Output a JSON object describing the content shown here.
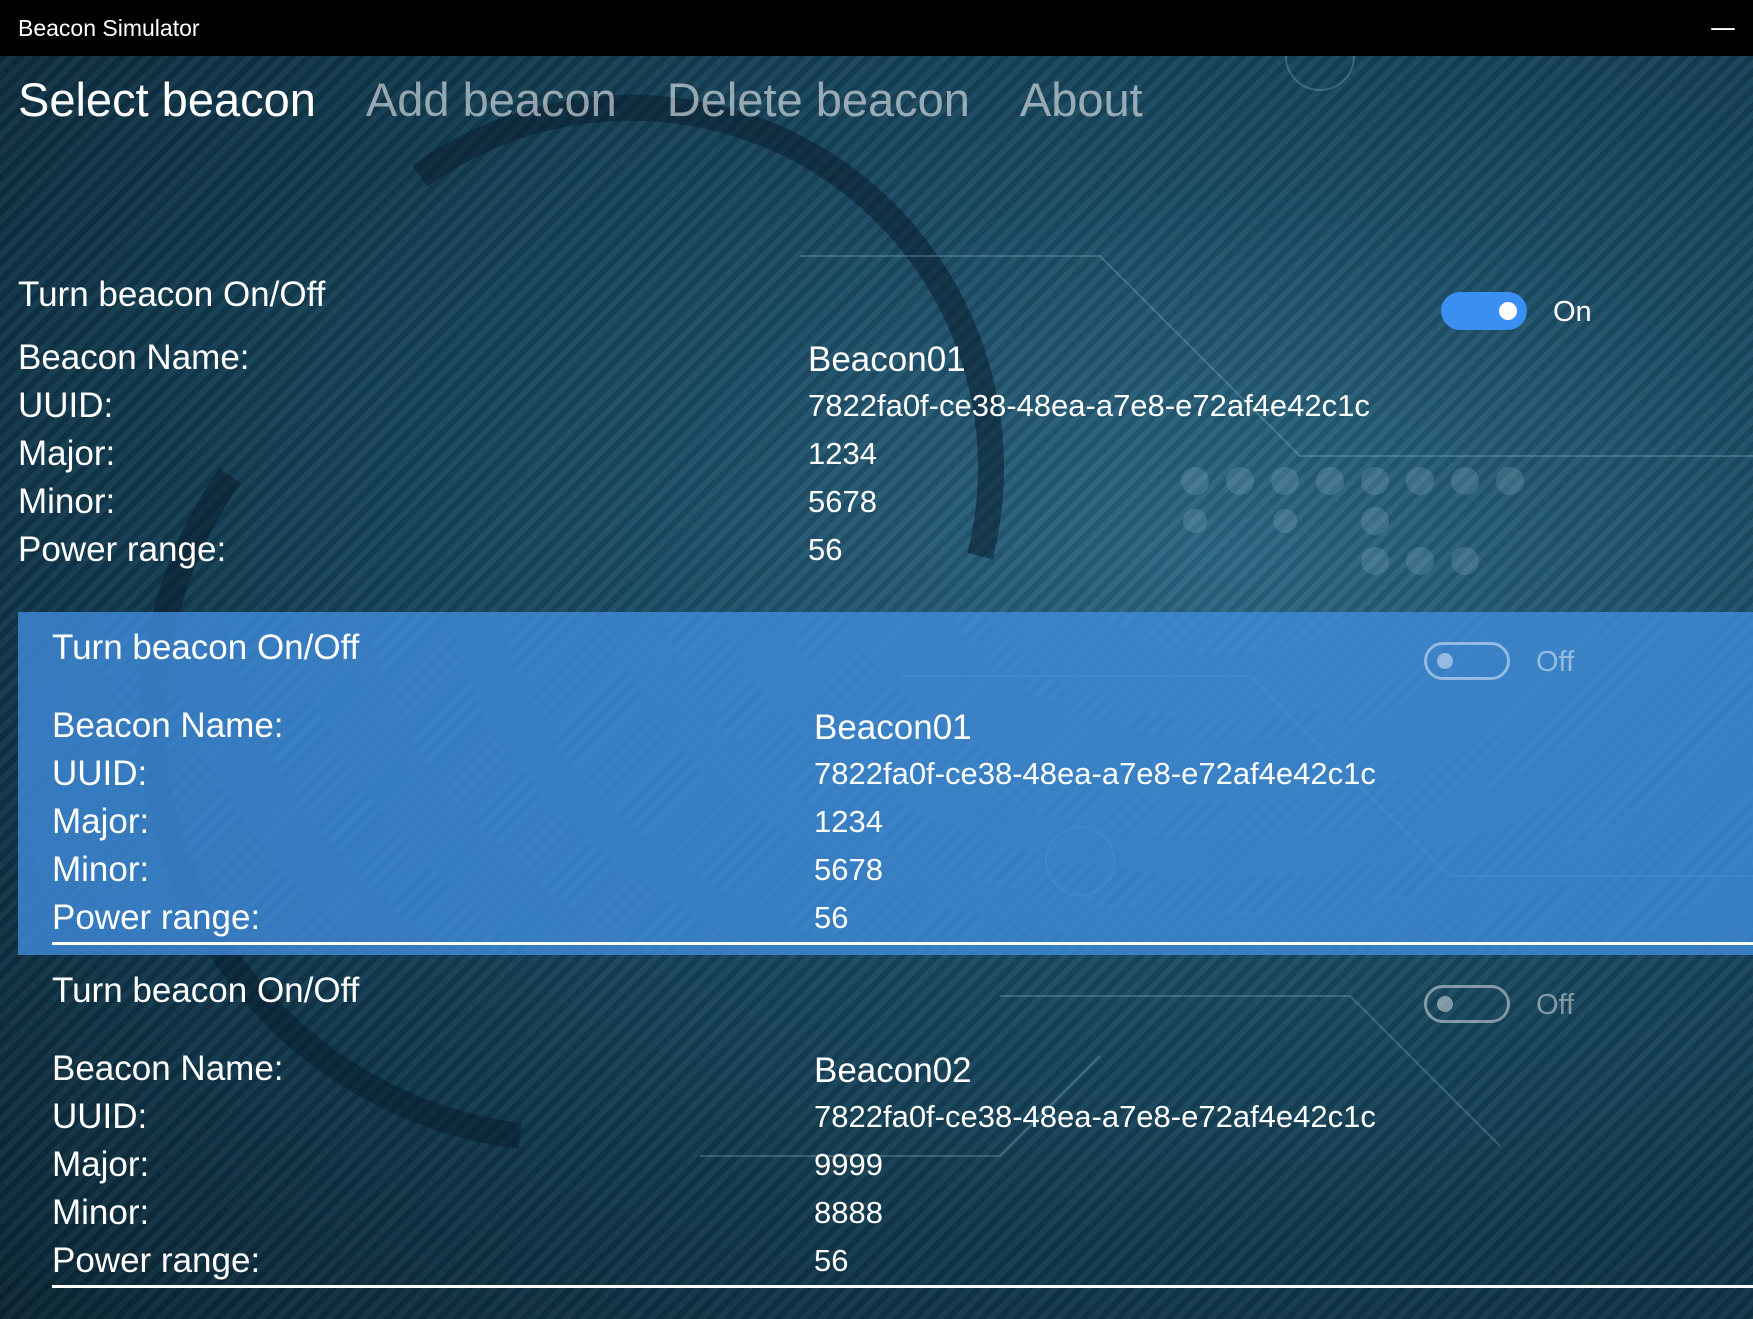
{
  "window": {
    "title": "Beacon Simulator",
    "minimize": "—"
  },
  "tabs": [
    {
      "label": "Select beacon",
      "active": true
    },
    {
      "label": "Add beacon",
      "active": false
    },
    {
      "label": "Delete beacon",
      "active": false
    },
    {
      "label": "About",
      "active": false
    }
  ],
  "labels": {
    "toggle": "Turn beacon On/Off",
    "name": "Beacon Name:",
    "uuid": "UUID:",
    "major": "Major:",
    "minor": "Minor:",
    "power": "Power range:"
  },
  "current": {
    "state": "On",
    "name": "Beacon01",
    "uuid": "7822fa0f-ce38-48ea-a7e8-e72af4e42c1c",
    "major": "1234",
    "minor": "5678",
    "power": "56"
  },
  "list": [
    {
      "selected": true,
      "state": "Off",
      "name": "Beacon01",
      "uuid": "7822fa0f-ce38-48ea-a7e8-e72af4e42c1c",
      "major": "1234",
      "minor": "5678",
      "power": "56"
    },
    {
      "selected": false,
      "state": "Off",
      "name": "Beacon02",
      "uuid": "7822fa0f-ce38-48ea-a7e8-e72af4e42c1c",
      "major": "9999",
      "minor": "8888",
      "power": "56"
    }
  ],
  "colors": {
    "accent": "#3a8ff3",
    "selection": "#408cdc",
    "titlebar": "#000000"
  }
}
